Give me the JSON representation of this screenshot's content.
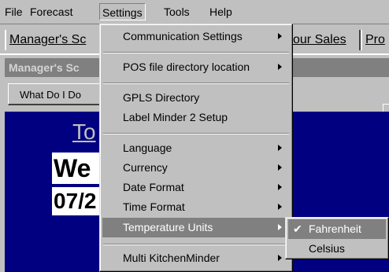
{
  "menubar": {
    "file": "File",
    "forecast": "Forecast",
    "settings": "Settings",
    "tools": "Tools",
    "help": "Help"
  },
  "tabs": {
    "managers": "Manager's Sc",
    "hour_sales": "our Sales",
    "pro": "Pro"
  },
  "inner": {
    "title": "Manager's Sc",
    "button": "What Do I Do",
    "big_label": "To",
    "line1": "We",
    "line2": "07/2"
  },
  "settings_menu": {
    "communication": "Communication Settings",
    "pos": "POS file directory location",
    "gpls": "GPLS Directory",
    "label_minder": "Label Minder 2 Setup",
    "language": "Language",
    "currency": "Currency",
    "date_format": "Date Format",
    "time_format": "Time Format",
    "temperature_units": "Temperature Units",
    "multi_kitchen": "Multi KitchenMinder"
  },
  "temp_menu": {
    "checkmark": "✔",
    "fahrenheit": "Fahrenheit",
    "celsius": "Celsius",
    "selected": "Fahrenheit"
  }
}
